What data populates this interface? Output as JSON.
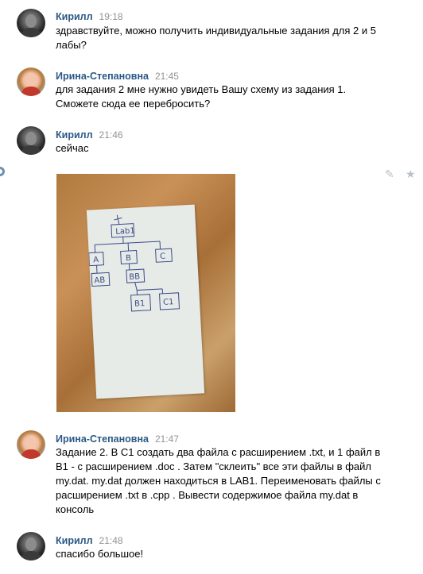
{
  "messages": [
    {
      "author": "Кирилл",
      "time": "19:18",
      "avatar": "male-avatar",
      "lines": [
        "здравствуйте, можно получить индивидуальные задания для 2 и 5",
        "лабы?"
      ]
    },
    {
      "author": "Ирина-Степановна",
      "time": "21:45",
      "avatar": "female-avatar",
      "lines": [
        "для задания 2 мне нужно увидеть Вашу схему из задания 1.",
        "Сможете сюда ее перебросить?"
      ]
    },
    {
      "author": "Кирилл",
      "time": "21:46",
      "avatar": "male-avatar",
      "lines": [
        "сейчас"
      ]
    },
    {
      "author": "Ирина-Степановна",
      "time": "21:47",
      "avatar": "female-avatar",
      "lines": [
        "Задание 2. В С1 создать два файла с расширением .txt, и 1 файл в",
        "B1 - с расширением .doc . Затем \"склеить\" все эти файлы в файл",
        "my.dat. my.dat должен находиться в LAB1. Переименовать файлы с",
        "расширением .txt в .cpp . Вывести содержимое файла my.dat в",
        "консоль"
      ]
    },
    {
      "author": "Кирилл",
      "time": "21:48",
      "avatar": "male-avatar",
      "lines": [
        "спасибо большое!"
      ]
    }
  ],
  "photo": {
    "diagram_labels": [
      "Lab1",
      "A",
      "B",
      "C",
      "AB",
      "BB",
      "B1",
      "C1"
    ]
  },
  "icons": {
    "edit": "pencil-icon",
    "favorite": "star-icon",
    "reply": "reply-icon"
  },
  "colors": {
    "author": "#2a5885",
    "time": "#939393",
    "text": "#000000"
  }
}
